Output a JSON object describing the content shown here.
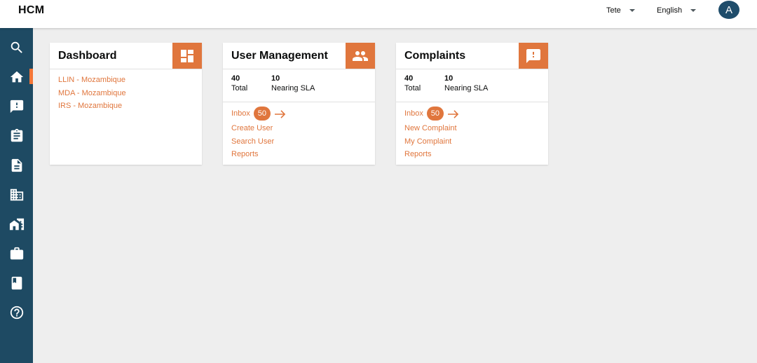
{
  "header": {
    "app_title": "HCM",
    "tenant": "Tete",
    "language": "English",
    "avatar_initial": "A"
  },
  "sidebar": {
    "items": [
      {
        "name": "search",
        "icon": "search-icon"
      },
      {
        "name": "home",
        "icon": "home-icon",
        "active": true
      },
      {
        "name": "complaints",
        "icon": "feedback-icon"
      },
      {
        "name": "assignment",
        "icon": "clipboard-icon"
      },
      {
        "name": "document",
        "icon": "document-icon"
      },
      {
        "name": "business",
        "icon": "building-icon"
      },
      {
        "name": "property",
        "icon": "house-city-icon"
      },
      {
        "name": "work",
        "icon": "briefcase-icon"
      },
      {
        "name": "book",
        "icon": "book-icon"
      },
      {
        "name": "help",
        "icon": "help-icon"
      }
    ]
  },
  "cards": {
    "dashboard": {
      "title": "Dashboard",
      "icon": "dashboard-icon",
      "links": [
        "LLIN - Mozambique",
        "MDA - Mozambique",
        "IRS - Mozambique"
      ]
    },
    "user_management": {
      "title": "User Management",
      "icon": "users-icon",
      "total_value": "40",
      "total_label": "Total",
      "sla_value": "10",
      "sla_label": "Nearing SLA",
      "inbox_label": "Inbox",
      "inbox_count": "50",
      "links": [
        "Create User",
        "Search User",
        "Reports"
      ]
    },
    "complaints": {
      "title": "Complaints",
      "icon": "feedback-icon",
      "total_value": "40",
      "total_label": "Total",
      "sla_value": "10",
      "sla_label": "Nearing SLA",
      "inbox_label": "Inbox",
      "inbox_count": "50",
      "links": [
        "New Complaint",
        "My Complaint",
        "Reports"
      ]
    }
  },
  "colors": {
    "accent": "#e0763d",
    "sidebar": "#1e4a63",
    "active_indicator": "#f47738"
  }
}
